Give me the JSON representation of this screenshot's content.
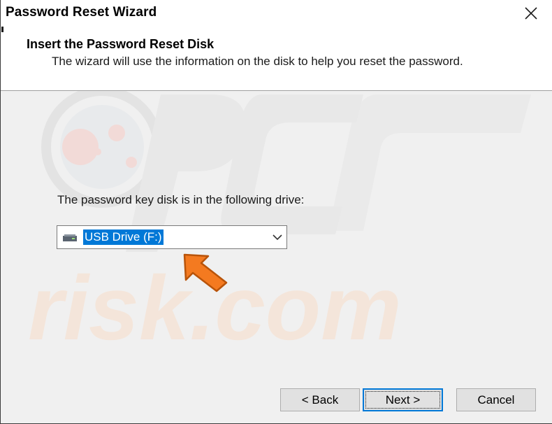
{
  "window": {
    "title": "Password Reset Wizard",
    "close_icon": "close-icon"
  },
  "header": {
    "title": "Insert the Password Reset Disk",
    "subtitle": "The wizard will use the information on the disk to help you reset the password."
  },
  "main": {
    "drive_label": "The password key disk is in the following drive:",
    "drive_select": {
      "value": "USB Drive (F:)",
      "icon": "usb-drive-icon",
      "dropdown_icon": "chevron-down-icon"
    },
    "annotation_arrow": {
      "icon": "pointer-arrow-icon",
      "color": "#f47a20"
    }
  },
  "watermark": {
    "text": "risk.com",
    "logo_text": "PC"
  },
  "buttons": {
    "back": "< Back",
    "next": "Next >",
    "cancel": "Cancel"
  },
  "colors": {
    "accent": "#0078d7",
    "selection": "#0078d7",
    "arrow": "#f47a20"
  }
}
